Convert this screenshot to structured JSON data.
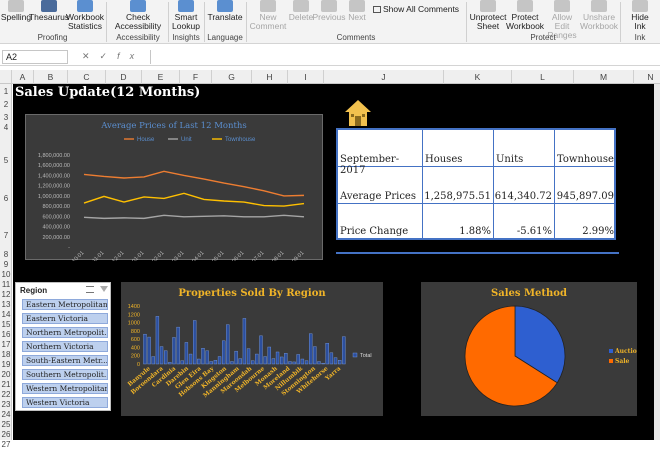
{
  "ribbon": {
    "buttons": [
      {
        "label": "Spelling",
        "disabled": false
      },
      {
        "label": "Thesaurus",
        "disabled": false
      },
      {
        "label": "Workbook Statistics",
        "disabled": false
      },
      {
        "label": "Check Accessibility",
        "disabled": false
      },
      {
        "label": "Smart Lookup",
        "disabled": false
      },
      {
        "label": "Translate",
        "disabled": false
      },
      {
        "label": "New Comment",
        "disabled": true
      },
      {
        "label": "Delete",
        "disabled": true
      },
      {
        "label": "Previous",
        "disabled": true
      },
      {
        "label": "Next",
        "disabled": true
      },
      {
        "label": "Unprotect Sheet",
        "disabled": false
      },
      {
        "label": "Protect Workbook",
        "disabled": false
      },
      {
        "label": "Allow Edit Ranges",
        "disabled": true
      },
      {
        "label": "Unshare Workbook",
        "disabled": true
      },
      {
        "label": "Hide Ink",
        "disabled": false
      }
    ],
    "show_all_comments": "Show All Comments",
    "groups": [
      "Proofing",
      "Accessibility",
      "Insights",
      "Language",
      "Comments",
      "Protect",
      "Ink"
    ]
  },
  "formula_bar": {
    "name_box": "A2",
    "cancel": "✕",
    "enter": "✓",
    "fx": "fx",
    "value": ""
  },
  "columns": [
    "A",
    "B",
    "C",
    "D",
    "E",
    "F",
    "G",
    "H",
    "I",
    "J",
    "K",
    "L",
    "M",
    "N"
  ],
  "rows": [
    "1",
    "2",
    "3",
    "4",
    "5",
    "6",
    "7",
    "8",
    "9",
    "10",
    "11",
    "12",
    "13",
    "14",
    "15",
    "16",
    "17",
    "18",
    "19",
    "20",
    "21",
    "22",
    "23",
    "24",
    "25",
    "26",
    "27"
  ],
  "sheet": {
    "title": "Sales Update(12 Months)"
  },
  "table": {
    "headers": [
      "September-2017",
      "Houses",
      "Units",
      "Townhouse"
    ],
    "rows": [
      [
        "Average Prices",
        "1,258,975.51",
        "614,340.72",
        "945,897.09"
      ],
      [
        "Price Change",
        "1.88%",
        "-5.61%",
        "2.99%"
      ]
    ]
  },
  "slicer": {
    "header": "Region",
    "items": [
      "Eastern Metropolitan",
      "Eastern Victoria",
      "Northern Metropolit...",
      "Northern Victoria",
      "South-Eastern Metr...",
      "Southern Metropolit...",
      "Western Metropolitan",
      "Western Victoria"
    ]
  },
  "colors": {
    "sheet_bg": "#000000",
    "chart_bg": "#3a3a3a",
    "accent_blue": "#4472c4",
    "title_gold": "#f0b428",
    "house_line": "#ed7d31",
    "unit_line": "#a5a5a5",
    "townhouse_line": "#ffc000",
    "auction_slice": "#2e5fd0",
    "sale_slice": "#ff6a00"
  },
  "chart_data": [
    {
      "type": "line",
      "title": "Average Prices of Last 12 Months",
      "x": [
        "2016-10-01",
        "2016-11-01",
        "2016-12-01",
        "2017-01-01",
        "2017-02-01",
        "2017-03-01",
        "2017-04-01",
        "2017-05-01",
        "2017-06-01",
        "2017-07-01",
        "2017-08-01",
        "2017-09-01"
      ],
      "series": [
        {
          "name": "House",
          "values": [
            1420000,
            1380000,
            1350000,
            1370000,
            1480000,
            1400000,
            1330000,
            1250000,
            1180000,
            1100000,
            1000000,
            1010000
          ]
        },
        {
          "name": "Unit",
          "values": [
            580000,
            560000,
            570000,
            560000,
            620000,
            590000,
            600000,
            610000,
            590000,
            590000,
            620000,
            590000
          ]
        },
        {
          "name": "Townhouse",
          "values": [
            860000,
            990000,
            880000,
            980000,
            950000,
            1050000,
            930000,
            900000,
            880000,
            810000,
            800000,
            850000
          ]
        }
      ],
      "ylim": [
        0,
        1800000
      ],
      "yticks": [
        "-",
        "200,000.00",
        "400,000.00",
        "600,000.00",
        "800,000.00",
        "1,000,000.00",
        "1,200,000.00",
        "1,400,000.00",
        "1,600,000.00",
        "1,800,000.00"
      ],
      "legend": "top",
      "grid": false
    },
    {
      "type": "bar",
      "title": "Properties Sold By Region",
      "categories": [
        "Banyule",
        "Boroondara",
        "Cardinia",
        "Darebin",
        "Glen Eira",
        "Hobsons Bay",
        "Kingston",
        "Manningham",
        "Maroondah",
        "Melbourne",
        "Monash",
        "Moreland",
        "Nillumbik",
        "Stonnington",
        "Whitehorse",
        "Yarra"
      ],
      "series": [
        {
          "name": "Total",
          "values": [
            720,
            650,
            180,
            1150,
            420,
            320,
            40,
            640,
            890,
            80,
            520,
            240,
            1050,
            120,
            380,
            320,
            60,
            90,
            180,
            560,
            950,
            60,
            310,
            130,
            1100,
            370,
            80,
            240,
            680,
            180,
            410,
            130,
            290,
            170,
            260,
            60,
            50,
            230,
            120,
            80,
            730,
            420,
            60,
            20,
            500,
            270,
            150,
            90,
            660
          ]
        }
      ],
      "ylim": [
        0,
        1400
      ],
      "yticks": [
        "0",
        "200",
        "400",
        "600",
        "800",
        "1000",
        "1200",
        "1400"
      ],
      "legend": "right"
    },
    {
      "type": "pie",
      "title": "Sales Method",
      "series": [
        {
          "name": "",
          "values": [
            34,
            66
          ]
        }
      ],
      "categories": [
        "Auction",
        "Sale"
      ],
      "legend": "right"
    }
  ]
}
